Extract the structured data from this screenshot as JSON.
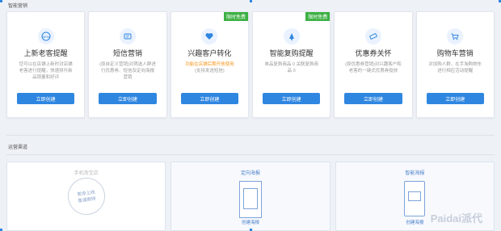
{
  "sections": {
    "smart_marketing": "智能营销",
    "operation_channel": "运营渠道"
  },
  "cards": [
    {
      "title": "上新老客提醒",
      "icon": "new-tag-icon",
      "desc": "您可以在店铺上新时对店铺老客进行提醒，快速拼升新品销量和好评",
      "desc_color": "gray",
      "badge": "",
      "button": "立即创建"
    },
    {
      "title": "短信营销",
      "icon": "sms-icon",
      "desc": "(原自定义营销)对筛选人群进行优惠券、短信及定向海报营销",
      "desc_color": "gray",
      "badge": "",
      "button": "立即创建"
    },
    {
      "title": "兴趣客户转化",
      "icon": "heart-icon",
      "desc": "功能在店铺后期开放使用",
      "desc2": "(支持发送短信)",
      "desc_color": "orange",
      "badge": "限时免费",
      "button": "立即创建"
    },
    {
      "title": "智能复购提醒",
      "icon": "bell-icon",
      "desc": "单品复购商品 0 关联复购商品 0",
      "desc_color": "gray",
      "badge": "限时免费",
      "button": "立即创建"
    },
    {
      "title": "优惠券关怀",
      "icon": "coupon-icon",
      "desc": "(原优惠券营销)对兴趣客户和老客的一键式优惠券投放",
      "desc_color": "gray",
      "badge": "",
      "button": "立即创建"
    },
    {
      "title": "购物车营销",
      "icon": "cart-icon",
      "desc": "对加购人群，在手淘购物车进行相应活动提醒",
      "desc_color": "gray",
      "badge": "",
      "button": "立即创建"
    }
  ],
  "channels": [
    {
      "title": "手机淘宝店",
      "stamp": [
        "暂停上线",
        "敬请期待"
      ],
      "foot": ""
    },
    {
      "title": "定向海报",
      "stamp": [],
      "foot": "创建海报"
    },
    {
      "title": "智能海报",
      "stamp": [],
      "foot": "创建海报"
    }
  ],
  "watermark": "Paidai派代",
  "colors": {
    "accent": "#2f86e0",
    "badge": "#3cb043",
    "orange": "#f59a23"
  }
}
